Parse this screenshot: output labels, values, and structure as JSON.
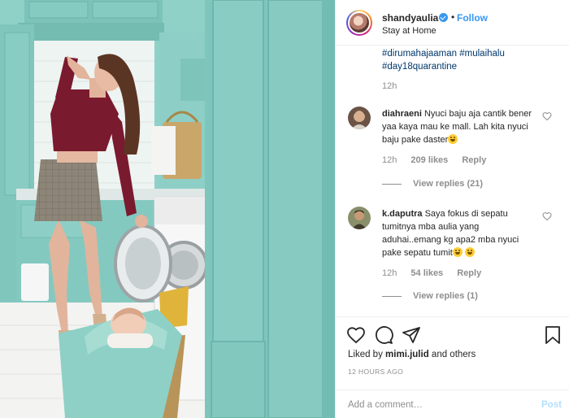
{
  "post": {
    "image_alt": "Photo by shandyaulia"
  },
  "header": {
    "username": "shandyaulia",
    "separator": "•",
    "follow_label": "Follow",
    "location": "Stay at Home",
    "verified_icon": "verified-badge-icon"
  },
  "caption": {
    "tags": [
      "#dirumahajaaman #mulaihalu",
      "#day18quarantine"
    ],
    "time": "12h"
  },
  "comments": [
    {
      "username": "diahraeni",
      "text": "Nyuci baju aja cantik bener yaa kaya mau ke mall. Lah kita nyuci baju pake daster",
      "time": "12h",
      "likes": "209 likes",
      "reply_label": "Reply",
      "view_replies": "View replies (21)"
    },
    {
      "username": "k.daputra",
      "text": "Saya fokus di sepatu tumitnya mba aulia yang aduhai..emang kg apa2 mba nyuci pake sepatu tumit",
      "time": "12h",
      "likes": "54 likes",
      "reply_label": "Reply",
      "view_replies": "View replies (1)"
    }
  ],
  "actions": {
    "icons": [
      "heart-icon",
      "comment-icon",
      "share-icon",
      "bookmark-icon"
    ],
    "liked_by_prefix": "Liked by",
    "liked_by_user": "mimi.julid",
    "liked_by_suffix": "and others",
    "timestamp": "12 HOURS AGO"
  },
  "add_comment": {
    "placeholder": "Add a comment…",
    "post_label": "Post"
  },
  "colors": {
    "link_blue": "#3897f0",
    "hashtag": "#00376b",
    "muted": "#8e8e8e",
    "post_disabled": "#b2dffc",
    "cabinet_teal": "#7fc5bd"
  }
}
